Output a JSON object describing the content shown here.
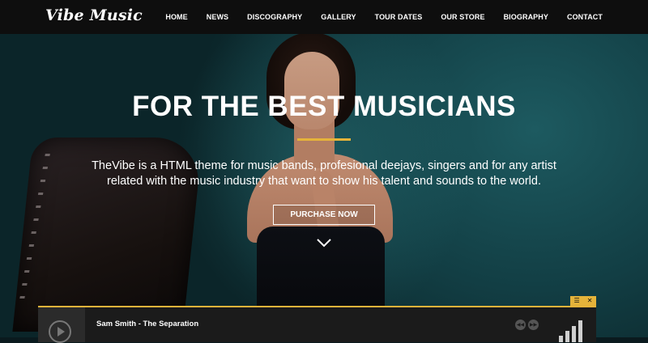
{
  "brand": {
    "logo_text": "Vibe Music"
  },
  "nav": {
    "items": [
      "HOME",
      "NEWS",
      "DISCOGRAPHY",
      "GALLERY",
      "TOUR DATES",
      "OUR STORE",
      "BIOGRAPHY",
      "CONTACT"
    ]
  },
  "hero": {
    "headline": "FOR THE BEST MUSICIANS",
    "description": "TheVibe is a HTML theme for music bands, profesional deejays, singers and for any artist related with the music industry that want to show his talent and sounds to the world.",
    "cta_label": "PURCHASE NOW",
    "scroll_icon": "chevron-down-icon"
  },
  "player": {
    "track_title": "Sam Smith - The Separation",
    "tab_icons": [
      "menu-icon",
      "close-icon"
    ],
    "prev_icon": "skip-back-icon",
    "next_icon": "skip-forward-icon",
    "play_icon": "play-icon",
    "volume_icon": "volume-bars-icon"
  },
  "colors": {
    "accent": "#e5b33a",
    "nav_background": "#0e0e0e",
    "player_background": "#1b1b1b"
  }
}
